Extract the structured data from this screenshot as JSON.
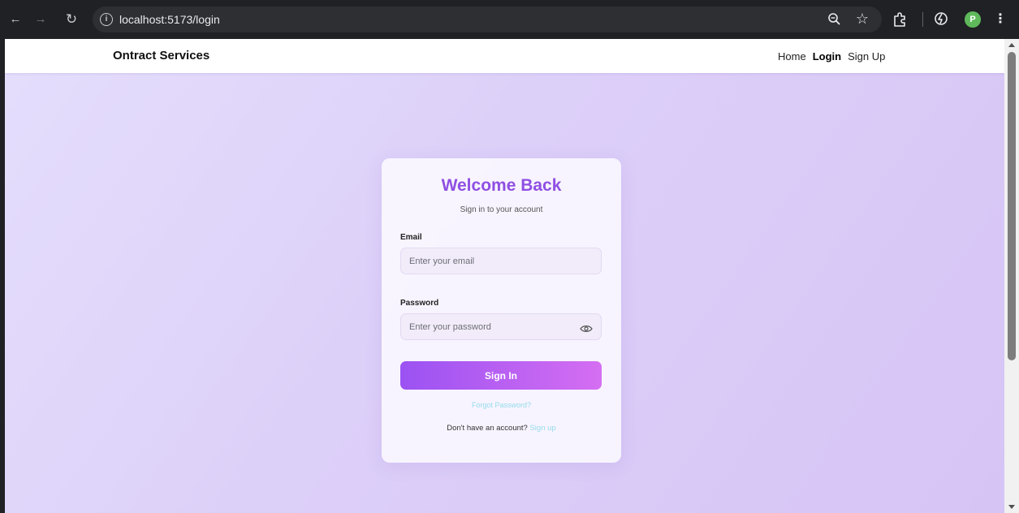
{
  "browser": {
    "url": "localhost:5173/login",
    "profile_initial": "P",
    "icons": [
      "back-arrow-icon",
      "forward-arrow-icon",
      "reload-icon",
      "info-icon",
      "zoom-icon",
      "bookmark-star-icon",
      "extensions-icon",
      "spark-icon",
      "menu-kebab-icon"
    ]
  },
  "header": {
    "brand": "Ontract Services",
    "nav": [
      {
        "label": "Home",
        "active": false
      },
      {
        "label": "Login",
        "active": true
      },
      {
        "label": "Sign Up",
        "active": false
      }
    ]
  },
  "login": {
    "title": "Welcome Back",
    "subtitle": "Sign in to your account",
    "email_label": "Email",
    "email_placeholder": "Enter your email",
    "password_label": "Password",
    "password_placeholder": "Enter your password",
    "submit_label": "Sign In",
    "forgot_label": "Forgot Password?",
    "no_account_text": "Don't have an account?",
    "signup_link": "Sign up"
  },
  "colors": {
    "accent": "#8f4fe3",
    "button_start": "#9b52f2",
    "button_end": "#d56ef2",
    "link": "#95dcea",
    "background": "#dccff8"
  }
}
